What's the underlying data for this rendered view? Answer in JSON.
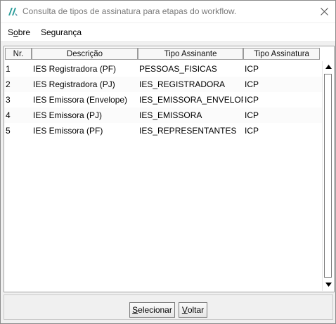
{
  "window": {
    "title": "Consulta de tipos de assinatura para etapas do workflow.",
    "close_glyph": "✕"
  },
  "menu": {
    "sobre": {
      "first": "S",
      "underlined": "o",
      "rest": "bre"
    },
    "seguranca": "Segurança"
  },
  "grid": {
    "columns": [
      "Nr.",
      "Descrição",
      "Tipo Assinante",
      "Tipo Assinatura"
    ],
    "rows": [
      [
        "1",
        "IES Registradora (PF)",
        "PESSOAS_FISICAS",
        "ICP"
      ],
      [
        "2",
        "IES Registradora (PJ)",
        "IES_REGISTRADORA",
        "ICP"
      ],
      [
        "3",
        "IES Emissora (Envelope)",
        "IES_EMISSORA_ENVELOPE",
        "ICP"
      ],
      [
        "4",
        "IES Emissora (PJ)",
        "IES_EMISSORA",
        "ICP"
      ],
      [
        "5",
        "IES Emissora (PF)",
        "IES_REPRESENTANTES",
        "ICP"
      ]
    ]
  },
  "buttons": {
    "selecionar": {
      "underlined": "S",
      "rest": "elecionar"
    },
    "voltar": {
      "underlined": "V",
      "rest": "oltar"
    }
  },
  "icons": {
    "app": "app-logo-icon",
    "close": "close-icon",
    "scroll_up": "scroll-up-arrow-icon",
    "scroll_down": "scroll-down-arrow-icon"
  },
  "colors": {
    "title_text": "#7a7a7a",
    "window_bg": "#f0f0f0",
    "logo": "#2a9d9a"
  }
}
